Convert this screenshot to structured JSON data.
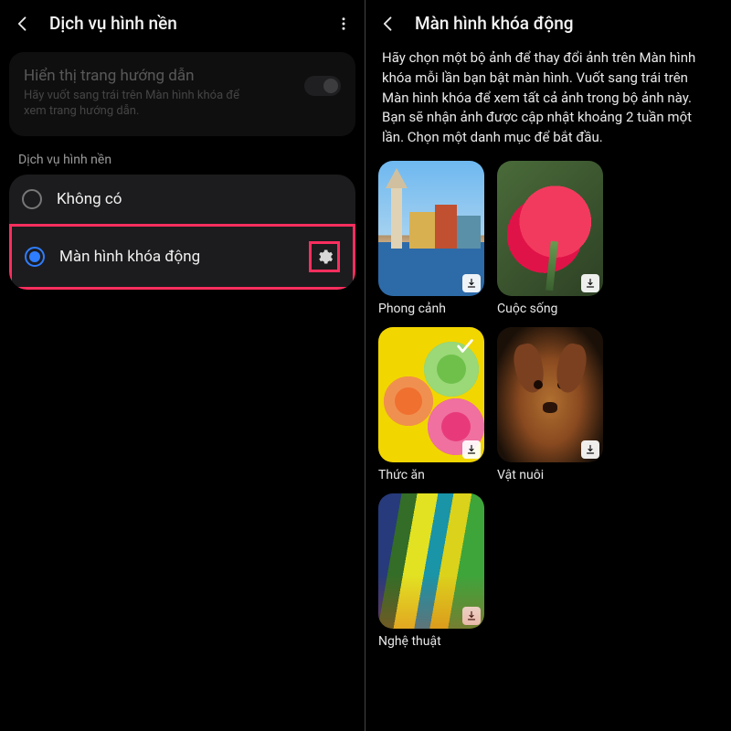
{
  "left": {
    "title": "Dịch vụ hình nền",
    "hint": {
      "title": "Hiển thị trang hướng dẫn",
      "sub": "Hãy vuốt sang trái trên Màn hình khóa để xem trang hướng dẫn.",
      "enabled": false
    },
    "section_label": "Dịch vụ hình nền",
    "options": [
      {
        "label": "Không có",
        "selected": false
      },
      {
        "label": "Màn hình khóa động",
        "selected": true,
        "has_settings": true,
        "highlighted": true
      }
    ]
  },
  "right": {
    "title": "Màn hình khóa động",
    "description": "Hãy chọn một bộ ảnh để thay đổi ảnh trên Màn hình khóa mỗi lần bạn bật màn hình. Vuốt sang trái trên Màn hình khóa để xem tất cả ảnh trong bộ ảnh này. Bạn sẽ nhận ảnh được cập nhật khoảng 2 tuần một lần. Chọn một danh mục để bắt đầu.",
    "categories": [
      {
        "label": "Phong cảnh",
        "downloadable": true
      },
      {
        "label": "Cuộc sống",
        "downloadable": true
      },
      {
        "label": "Thức ăn",
        "downloadable": true,
        "selected": true
      },
      {
        "label": "Vật nuôi",
        "downloadable": true
      },
      {
        "label": "Nghệ thuật",
        "downloadable": true
      }
    ]
  },
  "colors": {
    "accent": "#2f7dff",
    "highlight": "#fa2e5e"
  }
}
